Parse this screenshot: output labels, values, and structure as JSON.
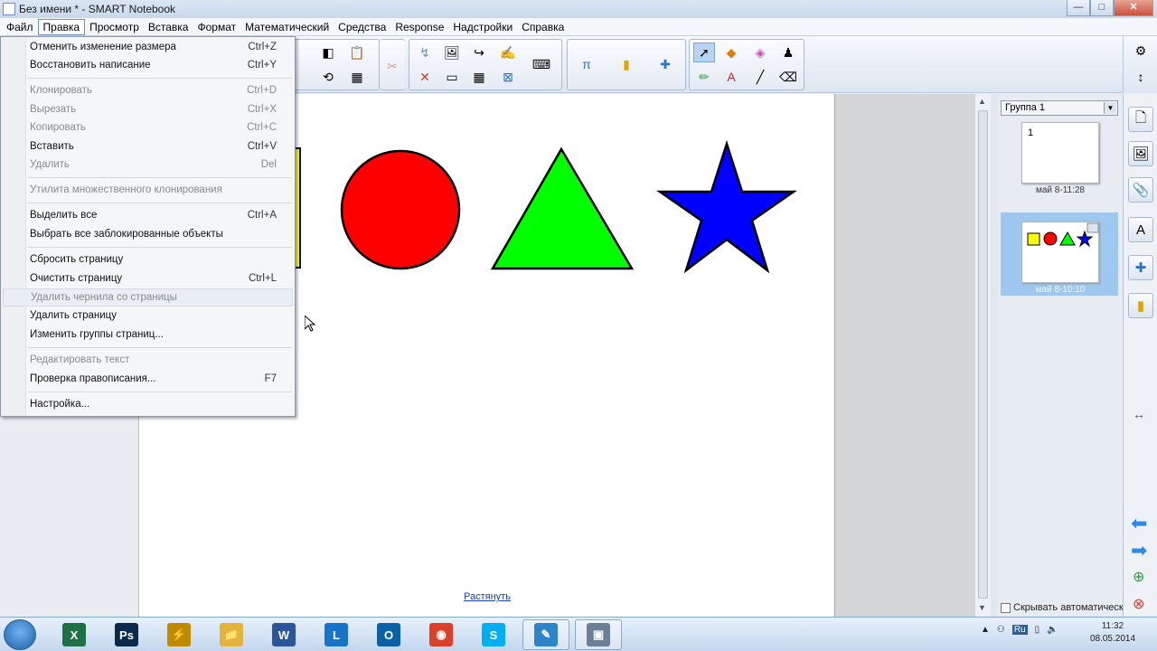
{
  "window": {
    "title": "Без имени * - SMART Notebook",
    "min": "—",
    "max": "□",
    "close": "✕"
  },
  "menubar": {
    "items": [
      "Файл",
      "Правка",
      "Просмотр",
      "Вставка",
      "Формат",
      "Математический",
      "Средства",
      "Response",
      "Надстройки",
      "Справка"
    ],
    "active": "Правка"
  },
  "edit_menu": {
    "undo": {
      "label": "Отменить изменение размера",
      "shortcut": "Ctrl+Z"
    },
    "redo": {
      "label": "Восстановить написание",
      "shortcut": "Ctrl+Y"
    },
    "clone": {
      "label": "Клонировать",
      "shortcut": "Ctrl+D"
    },
    "cut": {
      "label": "Вырезать",
      "shortcut": "Ctrl+X"
    },
    "copy": {
      "label": "Копировать",
      "shortcut": "Ctrl+C"
    },
    "paste": {
      "label": "Вставить",
      "shortcut": "Ctrl+V"
    },
    "delete": {
      "label": "Удалить",
      "shortcut": "Del"
    },
    "infinite_cloner": {
      "label": "Утилита множественного клонирования"
    },
    "select_all": {
      "label": "Выделить все",
      "shortcut": "Ctrl+A"
    },
    "select_locked": {
      "label": "Выбрать все заблокированные объекты"
    },
    "reset_page": {
      "label": "Сбросить страницу"
    },
    "clear_page": {
      "label": "Очистить страницу",
      "shortcut": "Ctrl+L"
    },
    "clear_ink": {
      "label": "Удалить чернила со страницы"
    },
    "delete_page": {
      "label": "Удалить страницу"
    },
    "edit_groups": {
      "label": "Изменить группы страниц..."
    },
    "edit_text": {
      "label": "Редактировать текст"
    },
    "spellcheck": {
      "label": "Проверка правописания...",
      "shortcut": "F7"
    },
    "settings": {
      "label": "Настройка..."
    }
  },
  "canvas": {
    "stretch_link": "Растянуть",
    "shapes": [
      {
        "name": "square",
        "color": "#FFFF00"
      },
      {
        "name": "circle",
        "color": "#FF0000"
      },
      {
        "name": "triangle",
        "color": "#00FF00"
      },
      {
        "name": "star",
        "color": "#0000FF"
      }
    ]
  },
  "page_sorter": {
    "group": "Группа 1",
    "pages": [
      {
        "number": "1",
        "date": "май 8-11:28"
      },
      {
        "number": "",
        "date": "май 8-10:10"
      }
    ],
    "autohide": "Скрывать автоматическ"
  },
  "taskbar": {
    "apps": [
      {
        "name": "excel",
        "glyph": "X",
        "color": "#1e7145"
      },
      {
        "name": "photoshop",
        "glyph": "Ps",
        "color": "#0a2a4a"
      },
      {
        "name": "winamp",
        "glyph": "⚡",
        "color": "#c08a00"
      },
      {
        "name": "explorer",
        "glyph": "📁",
        "color": "#e3b340"
      },
      {
        "name": "word",
        "glyph": "W",
        "color": "#2b579a"
      },
      {
        "name": "lync",
        "glyph": "L",
        "color": "#1a73c7"
      },
      {
        "name": "outlook",
        "glyph": "O",
        "color": "#0b61a8"
      },
      {
        "name": "chrome",
        "glyph": "◉",
        "color": "#d9412b"
      },
      {
        "name": "skype",
        "glyph": "S",
        "color": "#00aff0"
      },
      {
        "name": "notebook",
        "glyph": "✎",
        "color": "#2d84c8"
      },
      {
        "name": "smart-tools",
        "glyph": "▣",
        "color": "#6b7f99"
      }
    ],
    "language": "Ru",
    "time": "11:32",
    "date": "08.05.2014"
  }
}
